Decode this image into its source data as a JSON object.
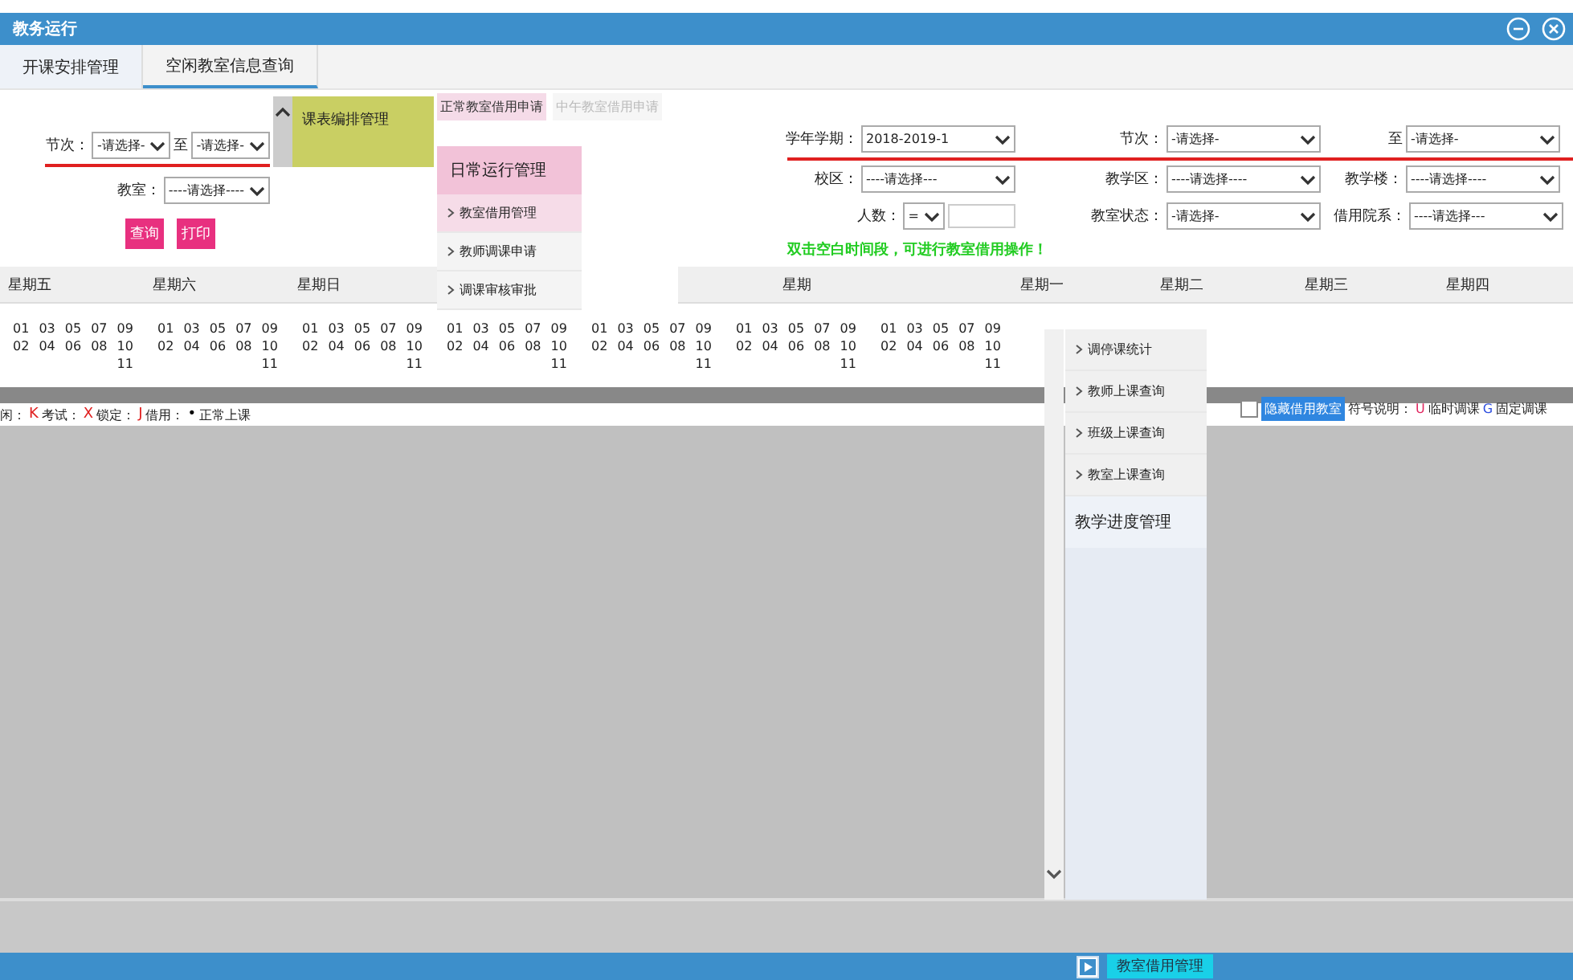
{
  "window": {
    "title": "教务运行"
  },
  "tabs": [
    {
      "label": "开课安排管理",
      "selected": false
    },
    {
      "label": "空闲教室信息查询",
      "selected": true
    }
  ],
  "floating_menu": {
    "label": "课表编排管理"
  },
  "left_filters": [
    {
      "fields": [
        {
          "label": "节次：",
          "value": "-请选择-"
        },
        {
          "label": "至",
          "value": "-请选择-"
        }
      ]
    },
    {
      "fields": [
        {
          "label": "教室：",
          "value": "----请选择----"
        }
      ]
    }
  ],
  "left_buttons": [
    "查询",
    "打印"
  ],
  "right_filters": [
    {
      "fields": [
        {
          "label": "学年学期：",
          "kind": "select",
          "value": "2018-2019-1"
        },
        {
          "label": "节次：",
          "kind": "select",
          "value": "-请选择-"
        },
        {
          "label": "至",
          "kind": "select",
          "value": "-请选择-"
        }
      ]
    },
    {
      "fields": [
        {
          "label": "校区：",
          "kind": "select",
          "value": "----请选择---"
        },
        {
          "label": "教学区：",
          "kind": "select",
          "value": "----请选择----"
        },
        {
          "label": "教学楼：",
          "kind": "select",
          "value": "----请选择----"
        }
      ]
    },
    {
      "fields": [
        {
          "label": "人数：",
          "kind": "compare",
          "value": "="
        },
        {
          "label": "教室状态：",
          "kind": "select",
          "value": "-请选择-"
        },
        {
          "label": "借用院系：",
          "kind": "select",
          "value": "----请选择---"
        }
      ]
    }
  ],
  "notice": "双击空白时间段，可进行教室借用操作！",
  "dropdown": {
    "subtabs": [
      {
        "label": "正常教室借用申请",
        "selected": true
      },
      {
        "label": "中午教室借用申请",
        "selected": false
      }
    ],
    "header": "日常运行管理",
    "items": [
      {
        "label": "教室借用管理",
        "selected": true
      },
      {
        "label": "教师调课申请",
        "selected": false
      },
      {
        "label": "调课审核审批",
        "selected": false
      }
    ]
  },
  "side_menu": {
    "items": [
      {
        "label": "调停课统计"
      },
      {
        "label": "教师上课查询"
      },
      {
        "label": "班级上课查询"
      },
      {
        "label": "教室上课查询"
      }
    ],
    "footer": "教学进度管理"
  },
  "days": [
    "星期五",
    "星期六",
    "星期日",
    "星期",
    "星期一",
    "星期二",
    "星期三",
    "星期四"
  ],
  "period_blocks": [
    [
      [
        "01",
        "02"
      ],
      [
        "03",
        "04"
      ],
      [
        "05",
        "06"
      ],
      [
        "07",
        "08"
      ],
      [
        "09",
        "10",
        "11"
      ]
    ],
    [
      [
        "01",
        "02"
      ],
      [
        "03",
        "04"
      ],
      [
        "05",
        "06"
      ],
      [
        "07",
        "08"
      ],
      [
        "09",
        "10",
        "11"
      ]
    ],
    [
      [
        "01",
        "02"
      ],
      [
        "03",
        "04"
      ],
      [
        "05",
        "06"
      ],
      [
        "07",
        "08"
      ],
      [
        "09",
        "10",
        "11"
      ]
    ],
    [
      [
        "01",
        "02"
      ],
      [
        "03",
        "04"
      ],
      [
        "05",
        "06"
      ],
      [
        "07",
        "08"
      ],
      [
        "09",
        "10",
        "11"
      ]
    ],
    [
      [
        "01",
        "02"
      ],
      [
        "03",
        "04"
      ],
      [
        "05",
        "06"
      ],
      [
        "07",
        "08"
      ],
      [
        "09",
        "10",
        "11"
      ]
    ],
    [
      [
        "01",
        "02"
      ],
      [
        "03",
        "04"
      ],
      [
        "05",
        "06"
      ],
      [
        "07",
        "08"
      ],
      [
        "09",
        "10",
        "11"
      ]
    ],
    [
      [
        "01",
        "02"
      ],
      [
        "03",
        "04"
      ],
      [
        "05",
        "06"
      ],
      [
        "07",
        "08"
      ],
      [
        "09",
        "10",
        "11"
      ]
    ]
  ],
  "legend_lead": "闲：",
  "legend": [
    {
      "symbol": "K",
      "label": "考试：",
      "color": "#e02020"
    },
    {
      "symbol": "X",
      "label": "锁定：",
      "color": "#e02020"
    },
    {
      "symbol": "J",
      "label": "借用：",
      "color": "#e02020"
    },
    {
      "symbol": "•",
      "label": "正常上课",
      "color": "#000000"
    }
  ],
  "hide_borrowed": {
    "checked": false,
    "label": "隐藏借用教室"
  },
  "symbols_title": "符号说明：",
  "symbols": [
    {
      "symbol": "U",
      "label": "临时调课",
      "color": "#e0245e"
    },
    {
      "symbol": "G",
      "label": "固定调课",
      "color": "#3050e0"
    }
  ],
  "taskbar": [
    {
      "label": "教室借用管理",
      "selected": true
    }
  ]
}
